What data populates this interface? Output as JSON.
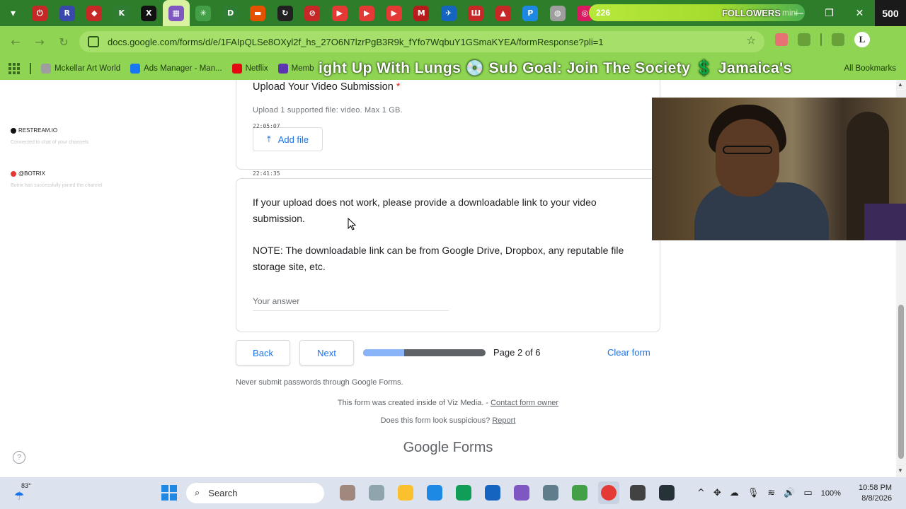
{
  "browser": {
    "url": "docs.google.com/forms/d/e/1FAIpQLSe8OXyl2f_hs_27O6N7lzrPgB3R9k_fYfo7WqbuY1GSmaKYEA/formResponse?pli=1",
    "tabs": [
      {
        "name": "tab-1",
        "glyph": "⏻",
        "color": "#c62828"
      },
      {
        "name": "tab-2",
        "glyph": "R",
        "color": "#3949ab"
      },
      {
        "name": "tab-3",
        "glyph": "◆",
        "color": "#c62828"
      },
      {
        "name": "tab-4",
        "glyph": "K",
        "color": "#2e7d32"
      },
      {
        "name": "tab-5",
        "glyph": "X",
        "color": "#111111"
      },
      {
        "name": "tab-6",
        "glyph": "▦",
        "color": "#7e57c2"
      },
      {
        "name": "tab-7",
        "glyph": "✳",
        "color": "#43a047"
      },
      {
        "name": "tab-8",
        "glyph": "D",
        "color": "#2e7d32"
      },
      {
        "name": "tab-9",
        "glyph": "▬",
        "color": "#e65100"
      },
      {
        "name": "tab-10",
        "glyph": "↻",
        "color": "#212121"
      },
      {
        "name": "tab-11",
        "glyph": "⊘",
        "color": "#c62828"
      },
      {
        "name": "tab-12",
        "glyph": "▶",
        "color": "#e53935"
      },
      {
        "name": "tab-13",
        "glyph": "▶",
        "color": "#e53935"
      },
      {
        "name": "tab-14",
        "glyph": "▶",
        "color": "#e53935"
      },
      {
        "name": "tab-15",
        "glyph": "M",
        "color": "#b71c1c"
      },
      {
        "name": "tab-16",
        "glyph": "✈",
        "color": "#1565c0"
      },
      {
        "name": "tab-17",
        "glyph": "Ш",
        "color": "#c62828"
      },
      {
        "name": "tab-18",
        "glyph": "▲",
        "color": "#c62828"
      },
      {
        "name": "tab-19",
        "glyph": "P",
        "color": "#1e88e5"
      },
      {
        "name": "tab-20",
        "glyph": "◍",
        "color": "#9e9e9e"
      },
      {
        "name": "tab-21",
        "glyph": "◎",
        "color": "#d81b60"
      }
    ],
    "followers": {
      "count": "226",
      "label": "FOLLOWERS",
      "mini": "mini",
      "goal": "500"
    },
    "bookmarks": [
      {
        "label": "Mckellar Art World",
        "color": "#9e9e9e"
      },
      {
        "label": "Ads Manager - Man...",
        "color": "#1877f2"
      },
      {
        "label": "Netflix",
        "color": "#e50914"
      },
      {
        "label": "Memb",
        "color": "#5e35b1"
      }
    ],
    "ticker": "ight Up With Lungs 💿 Sub Goal: Join The Society 💲 Jamaica's",
    "all_bookmarks": "All Bookmarks"
  },
  "overlay": {
    "chat": [
      {
        "source": "RESTREAM.IO",
        "faded": "Connected to chat of your channels",
        "color": "#111111"
      },
      {
        "source": "@BOTRIX",
        "faded": "Botrix has successfully joined the channel",
        "color": "#e53935"
      }
    ],
    "timestamps": {
      "first": "22:05:07",
      "second": "22:41:35"
    }
  },
  "form": {
    "upload_question": "Upload Your Video Submission",
    "required_mark": "*",
    "upload_hint": "Upload 1 supported file: video. Max 1 GB.",
    "add_file_label": "Add file",
    "link_desc_1": "If your upload does not work, please provide a downloadable link to your video submission.",
    "link_desc_2": "NOTE: The downloadable link can be from Google Drive, Dropbox, any reputable file storage site, etc.",
    "answer_placeholder": "Your answer",
    "back_label": "Back",
    "next_label": "Next",
    "progress_fraction": 0.333,
    "page_indicator": "Page 2 of 6",
    "clear_label": "Clear form",
    "never_submit": "Never submit passwords through Google Forms.",
    "created_text": "This form was created inside of Viz Media. - ",
    "contact_owner": "Contact form owner",
    "suspicious_text": "Does this form look suspicious? ",
    "report_label": "Report",
    "google_word": "Google",
    "forms_word": "Forms"
  },
  "taskbar": {
    "temperature": "83°",
    "search_label": "Search",
    "battery": "100%",
    "time": "10:58 PM",
    "date": "8/8/2026",
    "apps": [
      {
        "name": "app-cat-icon",
        "color": "#a1887f"
      },
      {
        "name": "app-taskview-icon",
        "color": "#90a4ae"
      },
      {
        "name": "app-explorer-icon",
        "color": "#fbc02d"
      },
      {
        "name": "app-help-icon",
        "color": "#1e88e5"
      },
      {
        "name": "app-edge-icon",
        "color": "#0f9d58"
      },
      {
        "name": "app-store-icon",
        "color": "#1565c0"
      },
      {
        "name": "app-copilot-icon",
        "color": "#7e57c2"
      },
      {
        "name": "app-settings-icon",
        "color": "#607d8b"
      },
      {
        "name": "app-recycle-icon",
        "color": "#43a047"
      },
      {
        "name": "app-chrome-icon",
        "color": "#e53935"
      },
      {
        "name": "app-obs-icon",
        "color": "#424242"
      },
      {
        "name": "app-terminal-icon",
        "color": "#263238"
      }
    ]
  }
}
